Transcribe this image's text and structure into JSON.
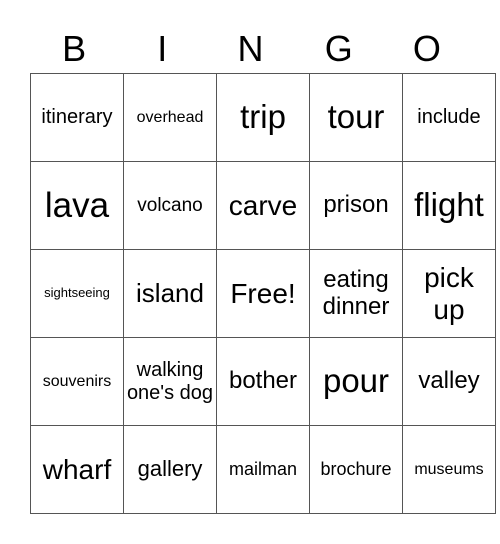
{
  "header": {
    "letters": [
      "B",
      "I",
      "N",
      "G",
      "O"
    ]
  },
  "grid": {
    "rows": [
      [
        "itinerary",
        "overhead",
        "trip",
        "tour",
        "include"
      ],
      [
        "lava",
        "volcano",
        "carve",
        "prison",
        "flight"
      ],
      [
        "sightseeing",
        "island",
        "Free!",
        "eating dinner",
        "pick up"
      ],
      [
        "souvenirs",
        "walking one's dog",
        "bother",
        "pour",
        "valley"
      ],
      [
        "wharf",
        "gallery",
        "mailman",
        "brochure",
        "museums"
      ]
    ]
  }
}
